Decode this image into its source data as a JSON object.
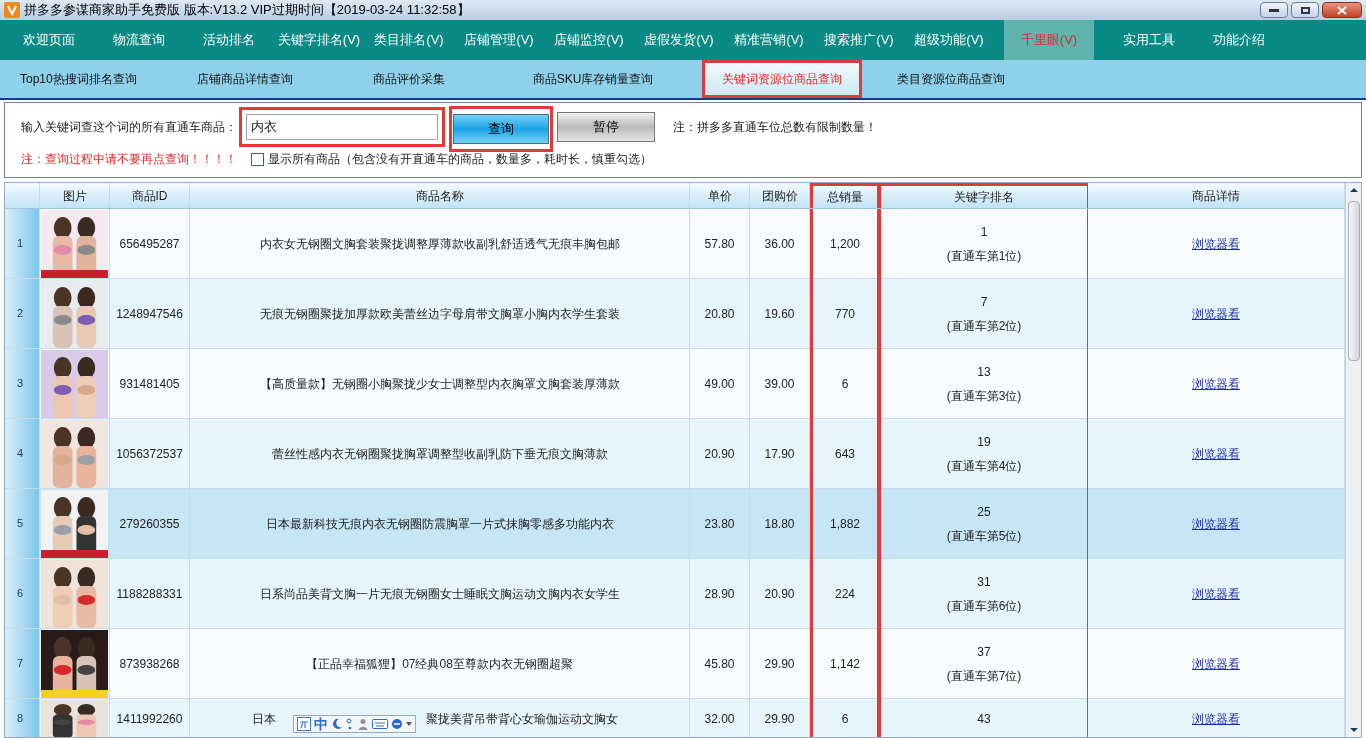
{
  "window": {
    "title": "拼多多参谋商家助手免费版 版本:V13.2 VIP过期时间【2019-03-24 11:32:58】"
  },
  "nav": [
    {
      "label": "欢迎页面",
      "selected": false
    },
    {
      "label": "物流查询",
      "selected": false
    },
    {
      "label": "活动排名",
      "selected": false
    },
    {
      "label": "关键字排名(V)",
      "selected": false
    },
    {
      "label": "类目排名(V)",
      "selected": false
    },
    {
      "label": "店铺管理(V)",
      "selected": false
    },
    {
      "label": "店铺监控(V)",
      "selected": false
    },
    {
      "label": "虚假发货(V)",
      "selected": false
    },
    {
      "label": "精准营销(V)",
      "selected": false
    },
    {
      "label": "搜索推广(V)",
      "selected": false
    },
    {
      "label": "超级功能(V)",
      "selected": false
    },
    {
      "label": "千里眼(V)",
      "selected": true
    },
    {
      "label": "实用工具",
      "selected": false
    },
    {
      "label": "功能介绍",
      "selected": false
    }
  ],
  "subnav": [
    {
      "label": "Top10热搜词排名查询",
      "selected": false,
      "highlighted": false
    },
    {
      "label": "店铺商品详情查询",
      "selected": false,
      "highlighted": false
    },
    {
      "label": "商品评价采集",
      "selected": false,
      "highlighted": false
    },
    {
      "label": "商品SKU库存销量查询",
      "selected": false,
      "highlighted": false
    },
    {
      "label": "关键词资源位商品查询",
      "selected": true,
      "highlighted": true
    },
    {
      "label": "类目资源位商品查询",
      "selected": false,
      "highlighted": false
    }
  ],
  "search": {
    "label": "输入关键词查这个词的所有直通车商品：",
    "value": "内衣",
    "highlighted": true,
    "query_button": {
      "label": "查询",
      "highlighted": true
    },
    "pause_button": {
      "label": "暂停"
    },
    "note": "注：拼多多直通车位总数有限制数量！",
    "warning": "注：查询过程中请不要再点查询！！！！",
    "show_all": {
      "label": "显示所有商品（包含没有开直通车的商品，数量多，耗时长，慎重勾选）",
      "checked": false
    }
  },
  "table": {
    "columns": [
      {
        "label": "图片",
        "highlighted": false
      },
      {
        "label": "商品ID",
        "highlighted": false
      },
      {
        "label": "商品名称",
        "highlighted": false
      },
      {
        "label": "单价",
        "highlighted": false
      },
      {
        "label": "团购价",
        "highlighted": false
      },
      {
        "label": "总销量",
        "highlighted": true
      },
      {
        "label": "关键字排名",
        "highlighted": true
      },
      {
        "label": "商品详情",
        "highlighted": false
      }
    ],
    "rows": [
      {
        "index": "1",
        "id": "656495287",
        "name": "内衣女无钢圈文胸套装聚拢调整厚薄款收副乳舒适透气无痕丰胸包邮",
        "price": "57.80",
        "group_price": "36.00",
        "sales": "1,200",
        "rank": "1",
        "rank_note": "(直通车第1位)",
        "link": "浏览器看",
        "selected": false
      },
      {
        "index": "2",
        "id": "1248947546",
        "name": "无痕无钢圈聚拢加厚款欧美蕾丝边字母肩带文胸罩小胸内衣学生套装",
        "price": "20.80",
        "group_price": "19.60",
        "sales": "770",
        "rank": "7",
        "rank_note": "(直通车第2位)",
        "link": "浏览器看",
        "selected": false
      },
      {
        "index": "3",
        "id": "931481405",
        "name": "【高质量款】无钢圈小胸聚拢少女士调整型内衣胸罩文胸套装厚薄款",
        "price": "49.00",
        "group_price": "39.00",
        "sales": "6",
        "rank": "13",
        "rank_note": "(直通车第3位)",
        "link": "浏览器看",
        "selected": false
      },
      {
        "index": "4",
        "id": "1056372537",
        "name": "蕾丝性感内衣无钢圈聚拢胸罩调整型收副乳防下垂无痕文胸薄款",
        "price": "20.90",
        "group_price": "17.90",
        "sales": "643",
        "rank": "19",
        "rank_note": "(直通车第4位)",
        "link": "浏览器看",
        "selected": false
      },
      {
        "index": "5",
        "id": "279260355",
        "name": "日本最新科技无痕内衣无钢圈防震胸罩一片式抹胸零感多功能内衣",
        "price": "23.80",
        "group_price": "18.80",
        "sales": "1,882",
        "rank": "25",
        "rank_note": "(直通车第5位)",
        "link": "浏览器看",
        "selected": true
      },
      {
        "index": "6",
        "id": "1188288331",
        "name": "日系尚品美背文胸一片无痕无钢圈女士睡眠文胸运动文胸内衣女学生",
        "price": "28.90",
        "group_price": "20.90",
        "sales": "224",
        "rank": "31",
        "rank_note": "(直通车第6位)",
        "link": "浏览器看",
        "selected": false
      },
      {
        "index": "7",
        "id": "873938268",
        "name": "【正品幸福狐狸】07经典08至尊款内衣无钢圈超聚",
        "price": "45.80",
        "group_price": "29.90",
        "sales": "1,142",
        "rank": "37",
        "rank_note": "(直通车第7位)",
        "link": "浏览器看",
        "selected": false
      },
      {
        "index": "8",
        "id": "1411992260",
        "name_parts": [
          "日本",
          "聚拢美背吊带背心女瑜伽运动文胸女"
        ],
        "price": "32.00",
        "group_price": "29.90",
        "sales": "6",
        "rank": "43",
        "link": "浏览器看",
        "selected": false
      }
    ]
  },
  "ime_toolbar": {
    "mode": "中"
  }
}
